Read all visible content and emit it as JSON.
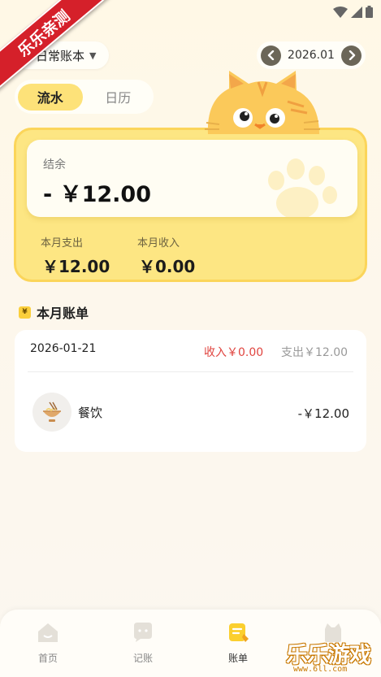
{
  "corner_ribbon": "乐乐亲测",
  "header": {
    "book_selector": "日常账本",
    "month": "2026.01"
  },
  "tabs": [
    {
      "label": "流水",
      "active": true
    },
    {
      "label": "日历",
      "active": false
    }
  ],
  "summary": {
    "balance_label": "结余",
    "balance_value": "- ￥12.00",
    "expense_label": "本月支出",
    "expense_value": "￥12.00",
    "income_label": "本月收入",
    "income_value": "￥0.00"
  },
  "section": {
    "badge": "¥",
    "title": "本月账单"
  },
  "bill_group": {
    "date": "2026-01-21",
    "income": "收入￥0.00",
    "expense": "支出￥12.00",
    "items": [
      {
        "category": "餐饮",
        "amount": "-￥12.00",
        "icon": "noodle-bowl-icon"
      }
    ]
  },
  "bottom_nav": [
    {
      "label": "首页",
      "icon": "home-icon",
      "active": false
    },
    {
      "label": "记账",
      "icon": "chat-icon",
      "active": false
    },
    {
      "label": "账单",
      "icon": "bill-icon",
      "active": true
    }
  ],
  "watermark": {
    "title": "乐乐游戏",
    "url": "www.6ll.com"
  },
  "colors": {
    "accent_yellow": "#fde279",
    "card_yellow": "#fde683",
    "income_red": "#e0443f",
    "nav_dark": "#6b6658"
  }
}
